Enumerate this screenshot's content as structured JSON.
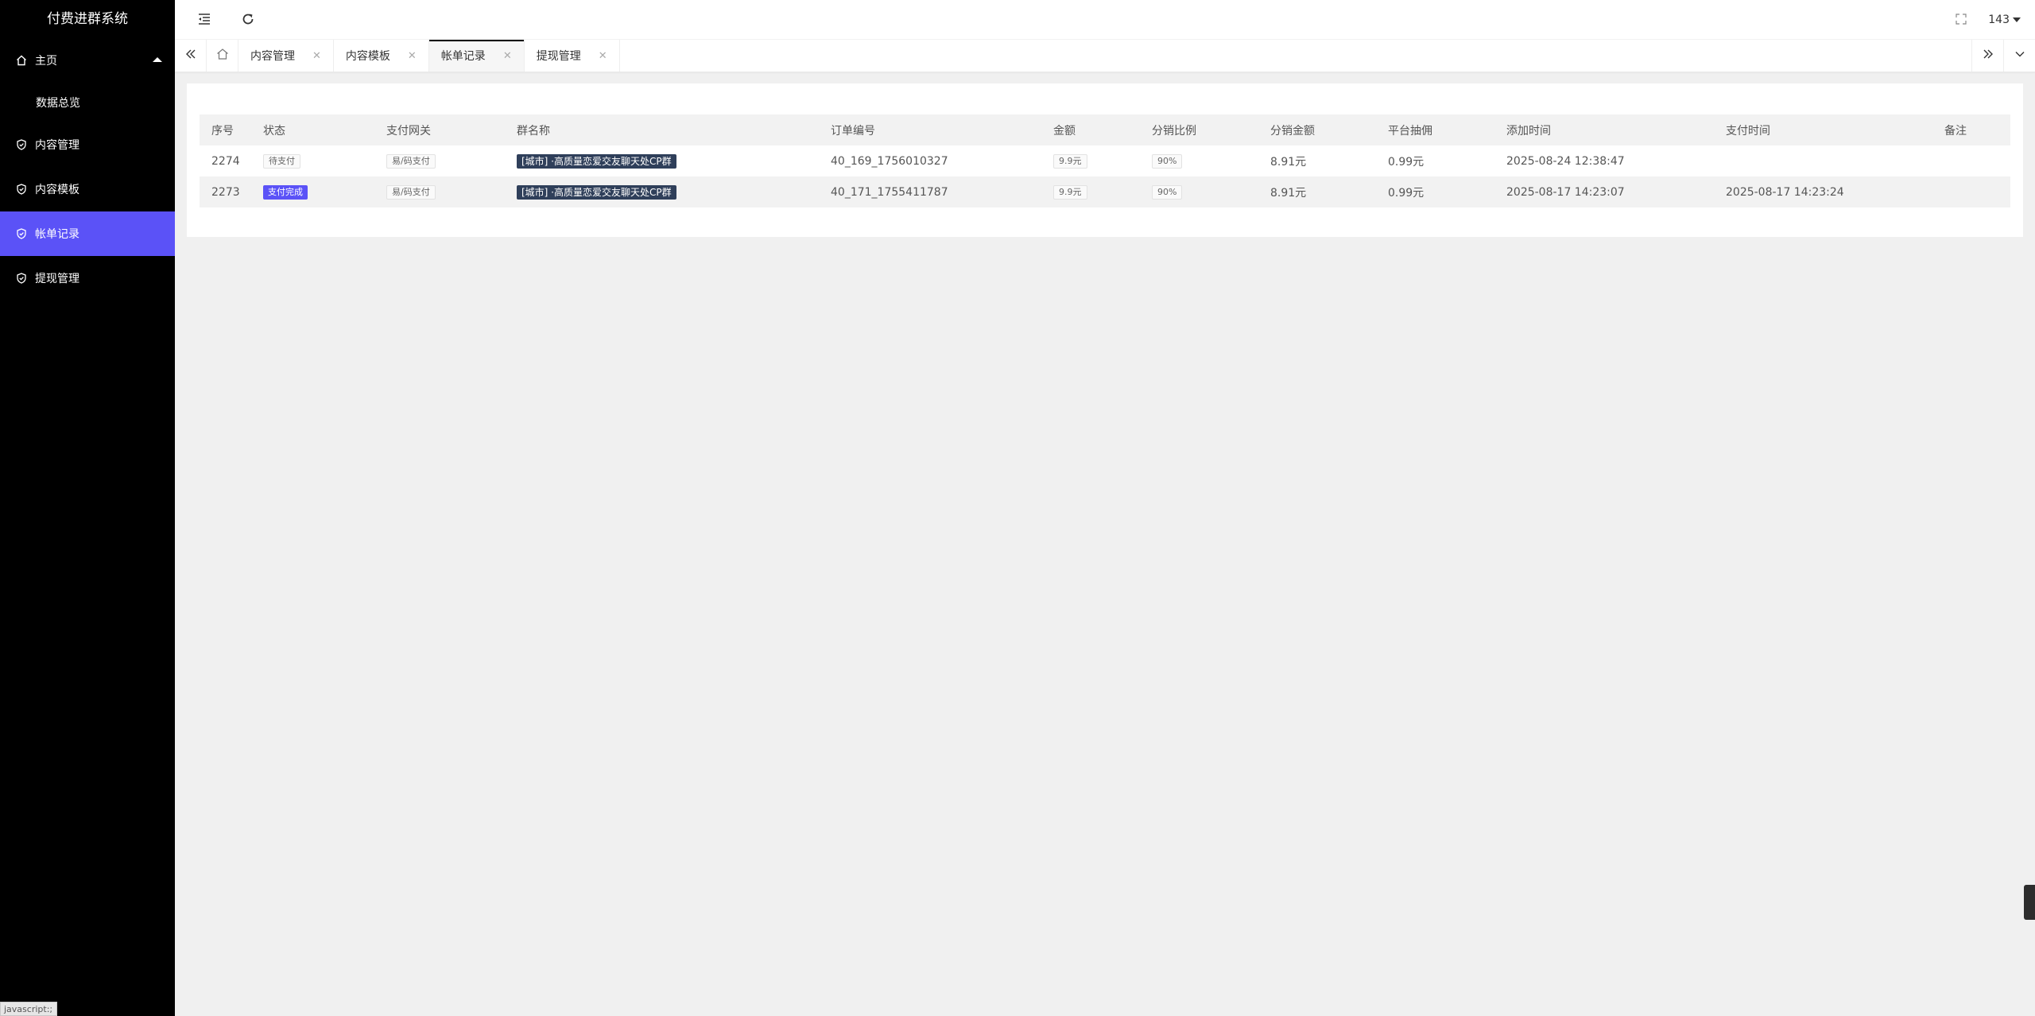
{
  "sidebar": {
    "logo": "付费进群系统",
    "home_label": "主页",
    "home_sub": "数据总览",
    "items": [
      {
        "label": "内容管理"
      },
      {
        "label": "内容模板"
      },
      {
        "label": "帐单记录"
      },
      {
        "label": "提现管理"
      }
    ],
    "active_index": 2,
    "status_tip": "javascript:;"
  },
  "header": {
    "user_name": "143"
  },
  "tabs": [
    {
      "label": "内容管理"
    },
    {
      "label": "内容模板"
    },
    {
      "label": "帐单记录"
    },
    {
      "label": "提现管理"
    }
  ],
  "table": {
    "columns": [
      "序号",
      "状态",
      "支付网关",
      "群名称",
      "订单编号",
      "金额",
      "分销比例",
      "分销金额",
      "平台抽佣",
      "添加时间",
      "支付时间",
      "备注"
    ],
    "rows": [
      {
        "id": "2274",
        "status": "待支付",
        "gateway": "易/码支付",
        "group": "[城市] ·高质量恋爱交友聊天处CP群",
        "order_no": "40_169_1756010327",
        "amount": "9.9元",
        "ratio": "90%",
        "dist_amount": "8.91元",
        "commission": "0.99元",
        "add_time": "2025-08-24 12:38:47",
        "pay_time": "",
        "remark": ""
      },
      {
        "id": "2273",
        "status": "支付完成",
        "gateway": "易/码支付",
        "group": "[城市] ·高质量恋爱交友聊天处CP群",
        "order_no": "40_171_1755411787",
        "amount": "9.9元",
        "ratio": "90%",
        "dist_amount": "8.91元",
        "commission": "0.99元",
        "add_time": "2025-08-17 14:23:07",
        "pay_time": "2025-08-17 14:23:24",
        "remark": ""
      }
    ]
  },
  "colors": {
    "accent": "#5b52f7",
    "sidebar_bg": "#000000",
    "tag_dark": "#2f3f5a"
  },
  "icons": [
    "menu-fold-icon",
    "refresh-icon",
    "fullscreen-icon",
    "home-icon",
    "shield-check-icon",
    "double-left-icon",
    "double-right-icon",
    "chevron-down-icon",
    "close-icon"
  ]
}
